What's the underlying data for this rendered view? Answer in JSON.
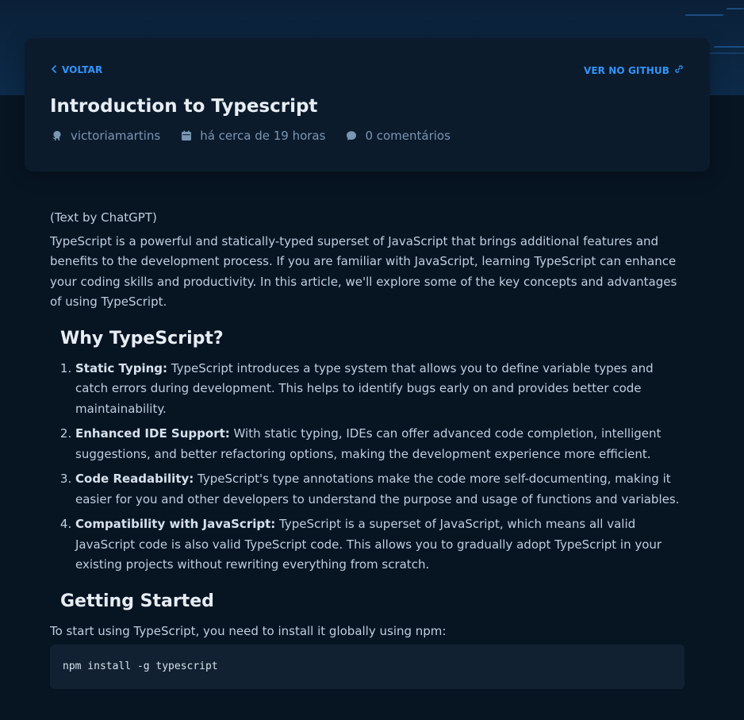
{
  "header": {
    "back_label": "VOLTAR",
    "github_label": "VER NO GITHUB",
    "title": "Introduction to Typescript",
    "meta": {
      "author": "victoriamartins",
      "date": "há cerca de 19 horas",
      "comments": "0 comentários"
    }
  },
  "article": {
    "intro_source": "(Text by ChatGPT)",
    "intro_paragraph": "TypeScript is a powerful and statically-typed superset of JavaScript that brings additional features and benefits to the development process. If you are familiar with JavaScript, learning TypeScript can enhance your coding skills and productivity. In this article, we'll explore some of the key concepts and advantages of using TypeScript.",
    "section1_heading": "Why TypeScript?",
    "reasons": [
      {
        "term": "Static Typing:",
        "text": " TypeScript introduces a type system that allows you to define variable types and catch errors during development. This helps to identify bugs early on and provides better code maintainability."
      },
      {
        "term": "Enhanced IDE Support:",
        "text": " With static typing, IDEs can offer advanced code completion, intelligent suggestions, and better refactoring options, making the development experience more efficient."
      },
      {
        "term": "Code Readability:",
        "text": " TypeScript's type annotations make the code more self-documenting, making it easier for you and other developers to understand the purpose and usage of functions and variables."
      },
      {
        "term": "Compatibility with JavaScript:",
        "text": " TypeScript is a superset of JavaScript, which means all valid JavaScript code is also valid TypeScript code. This allows you to gradually adopt TypeScript in your existing projects without rewriting everything from scratch."
      }
    ],
    "section2_heading": "Getting Started",
    "section2_paragraph": "To start using TypeScript, you need to install it globally using npm:",
    "code": "npm install -g typescript"
  },
  "icons": {
    "back": "chevron-left-icon",
    "github": "external-link-icon",
    "author": "github-icon",
    "date": "calendar-icon",
    "comments": "comment-icon"
  },
  "colors": {
    "background": "#071422",
    "card": "#0b1b2c",
    "accent": "#3294f8",
    "title": "#e7edf4",
    "meta": "#7b96b2",
    "body_text": "#bfcfdf",
    "code_bg": "#112131"
  }
}
